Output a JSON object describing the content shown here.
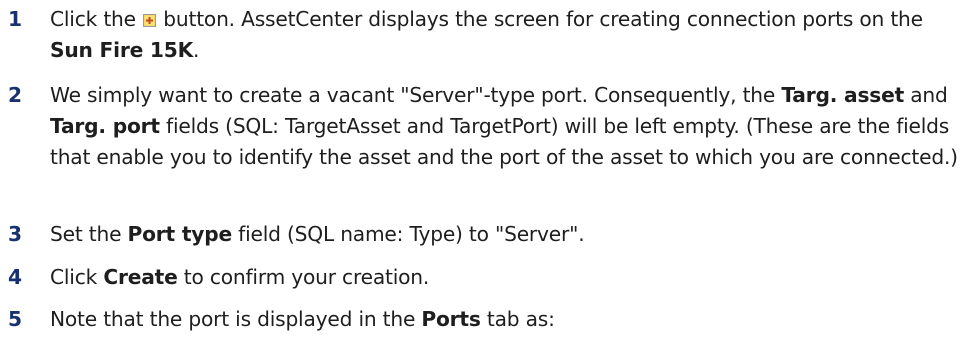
{
  "steps": [
    {
      "number": "1",
      "t1": "Click the ",
      "t2": " button. AssetCenter displays the screen for creating connection ports on the ",
      "b1": "Sun Fire 15K",
      "t3": "."
    },
    {
      "number": "2",
      "t1": "We simply want to create a vacant \"Server\"-type port. Consequently, the ",
      "b1": "Targ. asset",
      "t2": " and ",
      "b2": "Targ. port",
      "t3": " fields (SQL: TargetAsset and TargetPort) will be left empty. (These are the fields that enable you to identify the asset and the port of the asset to which you are connected.)"
    },
    {
      "number": "3",
      "t1": "Set the ",
      "b1": "Port type",
      "t2": " field (SQL name: Type) to \"Server\"."
    },
    {
      "number": "4",
      "t1": "Click ",
      "b1": "Create",
      "t2": " to confirm your creation."
    },
    {
      "number": "5",
      "t1": "Note that the port is displayed in the ",
      "b1": "Ports",
      "t2": " tab as:"
    }
  ],
  "icons": {
    "new_button_icon": "new-icon",
    "accent_color": "#17326e",
    "icon_fill": "#f5c518"
  }
}
